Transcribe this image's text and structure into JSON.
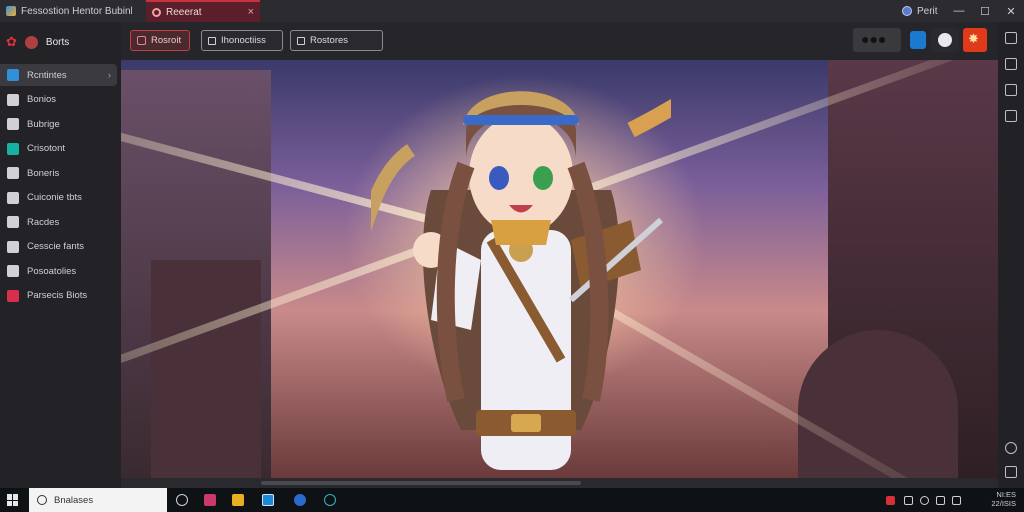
{
  "window": {
    "tab_first": "Fessostion Hentor Bubinhurs",
    "tab_active": "Reeerat",
    "tab_close": "×",
    "app_label": "Perit",
    "controls": {
      "minimize": "—",
      "maximize": "☐",
      "close": "✕"
    }
  },
  "sidebar": {
    "brand": "Borts",
    "items": [
      {
        "label": "Rcntintes",
        "icon": "globe-icon",
        "color": "#2f8fd8",
        "active": true
      },
      {
        "label": "Bonios",
        "icon": "brush-icon",
        "color": "#d0d0d6"
      },
      {
        "label": "Bubrige",
        "icon": "circle-tool-icon",
        "color": "#d0d0d6"
      },
      {
        "label": "Crisotont",
        "icon": "layers-icon",
        "color": "#18b0a0"
      },
      {
        "label": "Boneris",
        "icon": "panel-icon",
        "color": "#d0d0d6"
      },
      {
        "label": "Cuiconie tbts",
        "icon": "frame-icon",
        "color": "#d0d0d6"
      },
      {
        "label": "Racdes",
        "icon": "square-icon",
        "color": "#d0d0d6"
      },
      {
        "label": "Cesscie fants",
        "icon": "cube-icon",
        "color": "#d0d0d6"
      },
      {
        "label": "Posoatolies",
        "icon": "sliders-icon",
        "color": "#d0d0d6"
      },
      {
        "label": "Parsecis Biots",
        "icon": "swirl-icon",
        "color": "#d8304a"
      }
    ]
  },
  "toolbar": {
    "btn_primary": "Rosroit",
    "btn_second": "Ihonoctiiss",
    "btn_third": "Rostores"
  },
  "canvas": {
    "description_hidden": ""
  },
  "taskbar": {
    "search_placeholder": "Bnalases",
    "clock_time": "NI:ES",
    "clock_date": "22/ISIS"
  },
  "colors": {
    "accent": "#c8323c",
    "sidebar_bg": "#232327",
    "taskbar_bg": "#0f1214"
  }
}
